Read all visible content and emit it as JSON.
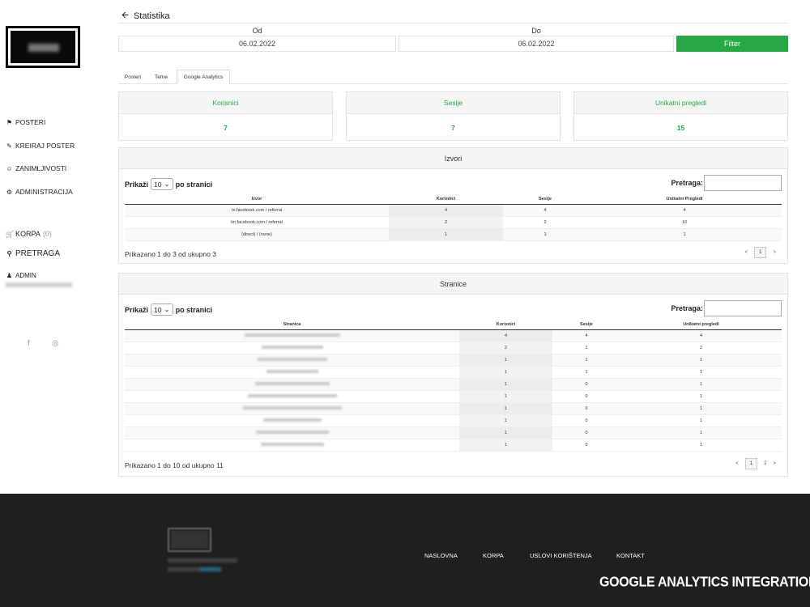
{
  "sidebar": {
    "nav": [
      {
        "label": "POSTERI",
        "icon": "tag-icon"
      },
      {
        "label": "KREIRAJ POSTER",
        "icon": "pencil-icon"
      },
      {
        "label": "ZANIMLJIVOSTI",
        "icon": "smile-icon"
      },
      {
        "label": "ADMINISTRACIJA",
        "icon": "gears-icon"
      }
    ],
    "cart": {
      "label": "KORPA",
      "count": "(0)",
      "icon": "cart-icon"
    },
    "search": {
      "label": "PRETRAGA",
      "icon": "search-icon"
    },
    "admin": {
      "label": "ADMIN",
      "icon": "user-icon"
    },
    "social": [
      {
        "icon": "facebook-icon",
        "glyph": "f"
      },
      {
        "icon": "instagram-icon",
        "glyph": "◎"
      }
    ]
  },
  "header": {
    "back_icon": "arrow-left-icon",
    "title": "Statistika"
  },
  "filters": {
    "from_label": "Od",
    "from_value": "06.02.2022",
    "to_label": "Do",
    "to_value": "06.02.2022",
    "button_label": "Filter"
  },
  "tabs": [
    {
      "label": "Posteri",
      "active": false
    },
    {
      "label": "Teme",
      "active": false
    },
    {
      "label": "Google Analytics",
      "active": true
    }
  ],
  "stats": [
    {
      "label": "Korisnici",
      "value": "7"
    },
    {
      "label": "Sesije",
      "value": "7"
    },
    {
      "label": "Unikatni pregledi",
      "value": "15"
    }
  ],
  "colors": {
    "accent": "#28a745",
    "footer_bg": "#1f1f1f"
  },
  "sources": {
    "title": "Izvori",
    "show_prefix": "Prikaži",
    "page_size": "10",
    "show_suffix": "po stranici",
    "search_label": "Pretraga:",
    "columns": [
      "Izvor",
      "Korisnici",
      "Sesije",
      "Unikatni Pregledi"
    ],
    "rows": [
      [
        "m.facebook.com / referral",
        "4",
        "4",
        "4"
      ],
      [
        "lm.facebook.com / referral",
        "2",
        "2",
        "10"
      ],
      [
        "(direct) / (none)",
        "1",
        "1",
        "1"
      ]
    ],
    "info": "Prikazano 1 do 3 od ukupno 3",
    "pagination": {
      "prev": "<",
      "pages": [
        "1"
      ],
      "next": ">"
    }
  },
  "pages": {
    "title": "Stranice",
    "show_prefix": "Prikaži",
    "page_size": "10",
    "show_suffix": "po stranici",
    "search_label": "Pretraga:",
    "columns": [
      "Stranica",
      "Korisnici",
      "Sesije",
      "Unikatni pregledi"
    ],
    "rows": [
      [
        "4",
        "4",
        "4"
      ],
      [
        "2",
        "1",
        "2"
      ],
      [
        "1",
        "1",
        "1"
      ],
      [
        "1",
        "1",
        "1"
      ],
      [
        "1",
        "0",
        "1"
      ],
      [
        "1",
        "0",
        "1"
      ],
      [
        "1",
        "0",
        "1"
      ],
      [
        "1",
        "0",
        "1"
      ],
      [
        "1",
        "0",
        "1"
      ],
      [
        "1",
        "0",
        "1"
      ]
    ],
    "info": "Prikazano 1 do 10 od ukupno 11",
    "pagination": {
      "prev": "<",
      "pages": [
        "1",
        "2"
      ],
      "next": ">"
    }
  },
  "footer": {
    "nav": [
      "NASLOVNA",
      "KORPA",
      "USLOVI KORIŠTENJA",
      "KONTAKT"
    ],
    "caption": "GOOGLE ANALYTICS INTEGRATION EXAMPLE"
  }
}
